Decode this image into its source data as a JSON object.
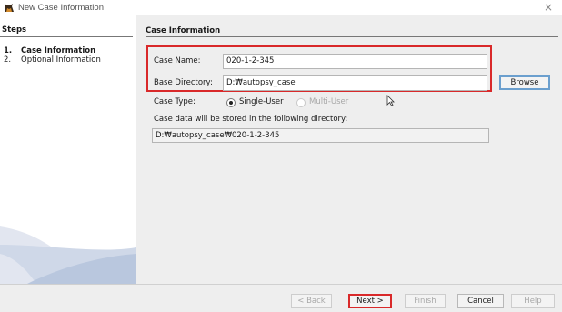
{
  "window": {
    "title": "New Case Information",
    "close_glyph": "×",
    "app_icon": "autopsy-dog-icon"
  },
  "steps": {
    "title": "Steps",
    "items": [
      {
        "num": "1.",
        "label": "Case Information",
        "active": true
      },
      {
        "num": "2.",
        "label": "Optional Information",
        "active": false
      }
    ]
  },
  "panel": {
    "title": "Case Information",
    "case_name_label": "Case Name:",
    "case_name_value": "020-1-2-345",
    "base_dir_label": "Base Directory:",
    "base_dir_value": "D:₩autopsy_case",
    "browse_label": "Browse",
    "case_type_label": "Case Type:",
    "single_user_label": "Single-User",
    "multi_user_label": "Multi-User",
    "case_type_selected": "Single-User",
    "storage_note": "Case data will be stored in the following directory:",
    "storage_path": "D:₩autopsy_case₩020-1-2-345"
  },
  "buttons": {
    "back": "< Back",
    "next": "Next >",
    "finish": "Finish",
    "cancel": "Cancel",
    "help": "Help"
  },
  "colors": {
    "highlight": "#d9292a",
    "focus_border": "#6b9fce",
    "background": "#eeeeee"
  }
}
